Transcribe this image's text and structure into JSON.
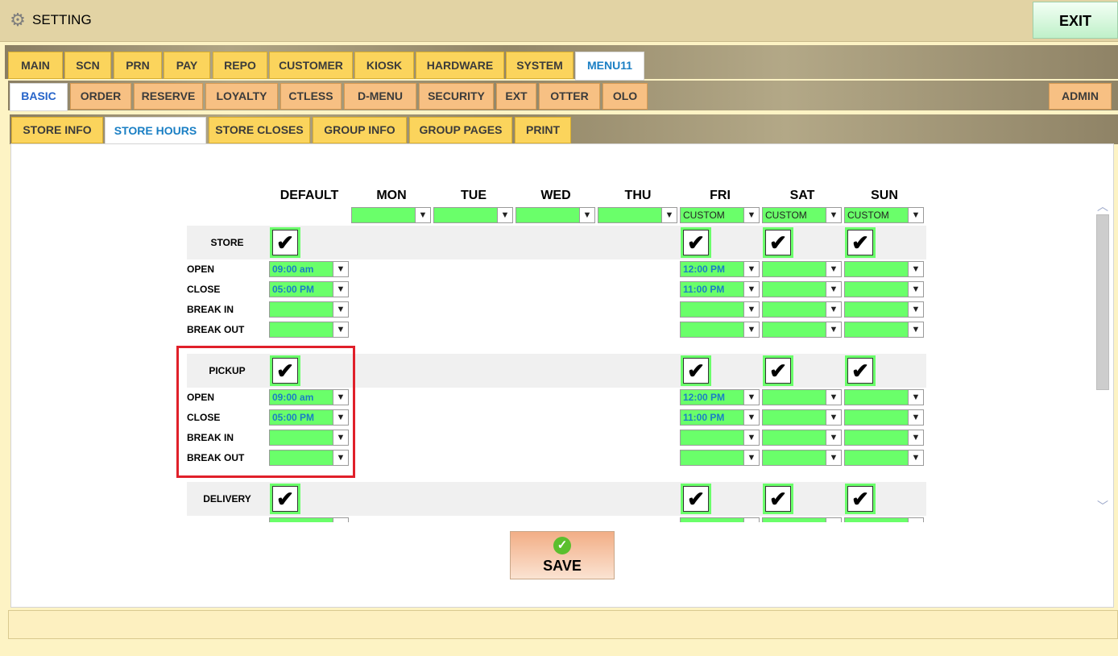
{
  "window": {
    "title": "SETTING",
    "exit_label": "EXIT"
  },
  "tabs_main": [
    {
      "label": "MAIN"
    },
    {
      "label": "SCN"
    },
    {
      "label": "PRN"
    },
    {
      "label": "PAY"
    },
    {
      "label": "REPO"
    },
    {
      "label": "CUSTOMER"
    },
    {
      "label": "KIOSK"
    },
    {
      "label": "HARDWARE"
    },
    {
      "label": "SYSTEM"
    },
    {
      "label": "MENU11"
    }
  ],
  "tabs_sub": [
    {
      "label": "BASIC"
    },
    {
      "label": "ORDER"
    },
    {
      "label": "RESERVE"
    },
    {
      "label": "LOYALTY"
    },
    {
      "label": "CTLESS"
    },
    {
      "label": "D-MENU"
    },
    {
      "label": "SECURITY"
    },
    {
      "label": "EXT"
    },
    {
      "label": "OTTER"
    },
    {
      "label": "OLO"
    },
    {
      "label": "ADMIN"
    }
  ],
  "tabs_section": [
    {
      "label": "STORE INFO"
    },
    {
      "label": "STORE HOURS"
    },
    {
      "label": "STORE CLOSES"
    },
    {
      "label": "GROUP INFO"
    },
    {
      "label": "GROUP PAGES"
    },
    {
      "label": "PRINT"
    }
  ],
  "active_tabs": {
    "main": "MENU11",
    "sub": "BASIC",
    "section": "STORE HOURS"
  },
  "schedule": {
    "days": [
      "DEFAULT",
      "MON",
      "TUE",
      "WED",
      "THU",
      "FRI",
      "SAT",
      "SUN"
    ],
    "day_modes": [
      "",
      "",
      "",
      "",
      "CUSTOM",
      "CUSTOM",
      "CUSTOM"
    ],
    "row_labels": {
      "open": "OPEN",
      "close": "CLOSE",
      "break_in": "BREAK IN",
      "break_out": "BREAK OUT"
    },
    "sections": [
      {
        "name": "STORE",
        "checked": true,
        "default": {
          "open": "09:00 am",
          "close": "05:00 PM",
          "break_in": "",
          "break_out": ""
        },
        "fri": {
          "open": "12:00 PM",
          "close": "11:00 PM"
        }
      },
      {
        "name": "PICKUP",
        "checked": true,
        "default": {
          "open": "09:00 am",
          "close": "05:00 PM",
          "break_in": "",
          "break_out": ""
        },
        "fri": {
          "open": "12:00 PM",
          "close": "11:00 PM"
        }
      },
      {
        "name": "DELIVERY",
        "checked": true
      }
    ]
  },
  "save_label": "SAVE",
  "icons": {
    "gear": "gear-icon",
    "save": "check-circle-icon",
    "dropdown": "chevron-down-icon"
  }
}
